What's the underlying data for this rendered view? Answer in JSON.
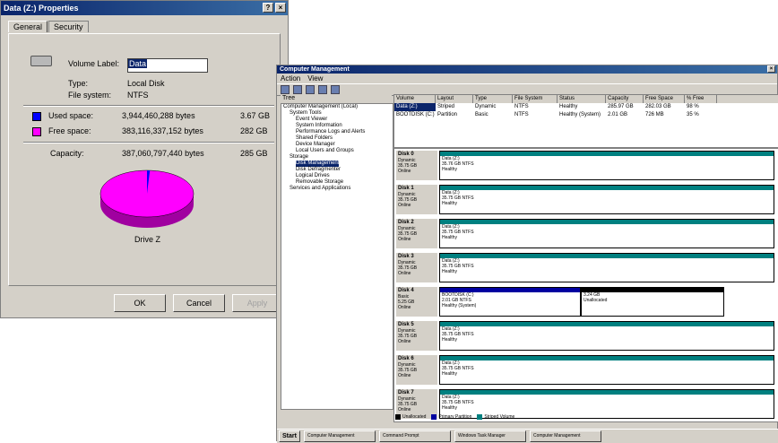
{
  "props": {
    "title": "Data (Z:) Properties",
    "tabs": [
      "General",
      "Security"
    ],
    "volume_label_caption": "Volume Label:",
    "volume_label_value": "Data",
    "type_caption": "Type:",
    "type_value": "Local Disk",
    "fs_caption": "File system:",
    "fs_value": "NTFS",
    "used_caption": "Used space:",
    "used_bytes": "3,944,460,288 bytes",
    "used_gb": "3.67 GB",
    "free_caption": "Free space:",
    "free_bytes": "383,116,337,152 bytes",
    "free_gb": "282 GB",
    "capacity_caption": "Capacity:",
    "capacity_bytes": "387,060,797,440 bytes",
    "capacity_gb": "285 GB",
    "drive_label": "Drive Z",
    "ok": "OK",
    "cancel": "Cancel",
    "apply": "Apply",
    "used_color": "#0000ff",
    "free_color": "#ff00ff",
    "used_fraction": 0.01
  },
  "cm": {
    "title": "Computer Management",
    "menu": [
      "Action",
      "View"
    ],
    "tree_header": "Tree",
    "tree": [
      "Computer Management (Local)",
      "System Tools",
      "Event Viewer",
      "System Information",
      "Performance Logs and Alerts",
      "Shared Folders",
      "Device Manager",
      "Local Users and Groups",
      "Storage",
      "Disk Management",
      "Disk Defragmenter",
      "Logical Drives",
      "Removable Storage",
      "Services and Applications"
    ],
    "list_headers": [
      "Volume",
      "Layout",
      "Type",
      "File System",
      "Status",
      "Capacity",
      "Free Space",
      "% Free"
    ],
    "list_rows": [
      [
        "Data (Z:)",
        "Striped",
        "Dynamic",
        "NTFS",
        "Healthy",
        "285.97 GB",
        "282.03 GB",
        "98 %"
      ],
      [
        "BOOTDISK (C:)",
        "Partition",
        "Basic",
        "NTFS",
        "Healthy (System)",
        "2.01 GB",
        "726 MB",
        "35 %"
      ]
    ],
    "disks": [
      {
        "name": "Disk 0",
        "type": "Dynamic",
        "size": "35.75 GB",
        "state": "Online",
        "vol_name": "Data (Z:)",
        "vol_size": "35.76 GB NTFS",
        "vol_status": "Healthy"
      },
      {
        "name": "Disk 1",
        "type": "Dynamic",
        "size": "35.75 GB",
        "state": "Online",
        "vol_name": "Data (Z:)",
        "vol_size": "35.75 GB NTFS",
        "vol_status": "Healthy"
      },
      {
        "name": "Disk 2",
        "type": "Dynamic",
        "size": "35.75 GB",
        "state": "Online",
        "vol_name": "Data (Z:)",
        "vol_size": "35.75 GB NTFS",
        "vol_status": "Healthy"
      },
      {
        "name": "Disk 3",
        "type": "Dynamic",
        "size": "35.75 GB",
        "state": "Online",
        "vol_name": "Data (Z:)",
        "vol_size": "35.75 GB NTFS",
        "vol_status": "Healthy"
      },
      {
        "name": "Disk 4",
        "type": "Basic",
        "size": "5.25 GB",
        "state": "Online",
        "vol_name": "BOOTDISK (C:)",
        "vol_size": "2.01 GB NTFS",
        "vol_status": "Healthy (System)",
        "unalloc_size": "3.24 GB",
        "unalloc_label": "Unallocated"
      },
      {
        "name": "Disk 5",
        "type": "Dynamic",
        "size": "35.75 GB",
        "state": "Online",
        "vol_name": "Data (Z:)",
        "vol_size": "35.75 GB NTFS",
        "vol_status": "Healthy"
      },
      {
        "name": "Disk 6",
        "type": "Dynamic",
        "size": "35.75 GB",
        "state": "Online",
        "vol_name": "Data (Z:)",
        "vol_size": "35.75 GB NTFS",
        "vol_status": "Healthy"
      },
      {
        "name": "Disk 7",
        "type": "Dynamic",
        "size": "35.75 GB",
        "state": "Online",
        "vol_name": "Data (Z:)",
        "vol_size": "35.75 GB NTFS",
        "vol_status": "Healthy"
      }
    ],
    "legend": [
      "Unallocated",
      "Primary Partition",
      "Striped Volume"
    ],
    "taskbar": [
      "Start",
      "Computer Management",
      "Command Prompt",
      "Windows Task Manager",
      "Computer Management"
    ]
  }
}
